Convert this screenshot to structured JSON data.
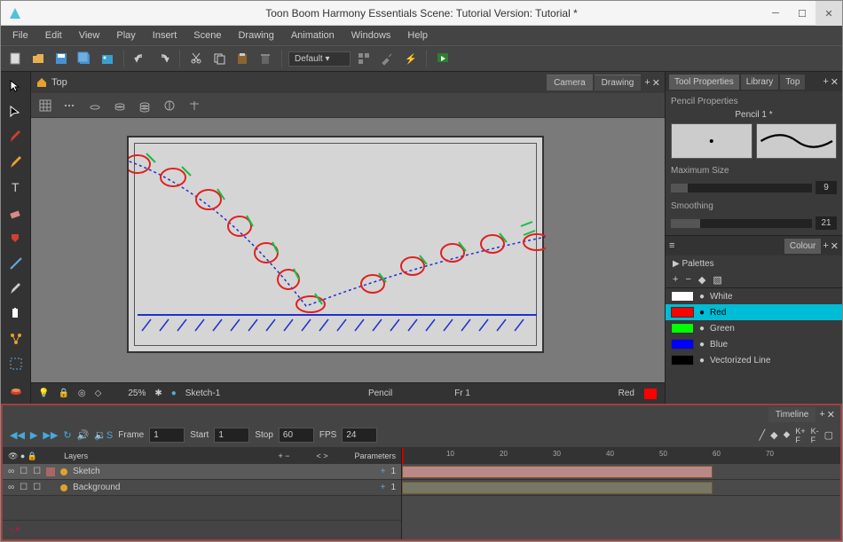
{
  "title": "Toon Boom Harmony Essentials Scene: Tutorial Version: Tutorial *",
  "menu": [
    "File",
    "Edit",
    "View",
    "Play",
    "Insert",
    "Scene",
    "Drawing",
    "Animation",
    "Windows",
    "Help"
  ],
  "toolbar": {
    "preset": "Default"
  },
  "canvas": {
    "top_label": "Top",
    "tabs": [
      "Camera",
      "Drawing"
    ],
    "active_tab": "Camera"
  },
  "status": {
    "zoom": "25%",
    "layer": "Sketch-1",
    "tool": "Pencil",
    "frame": "Fr 1",
    "colour": "Red"
  },
  "tool_props": {
    "tabs": [
      "Tool Properties",
      "Library",
      "Top"
    ],
    "section": "Pencil Properties",
    "brush_name": "Pencil 1 *",
    "max_size_label": "Maximum Size",
    "max_size": "9",
    "smoothing_label": "Smoothing",
    "smoothing": "21"
  },
  "colour": {
    "title": "Colour",
    "palettes": "Palettes",
    "items": [
      {
        "name": "White",
        "hex": "#ffffff"
      },
      {
        "name": "Red",
        "hex": "#ff0000"
      },
      {
        "name": "Green",
        "hex": "#00ff00"
      },
      {
        "name": "Blue",
        "hex": "#0000ff"
      },
      {
        "name": "Vectorized Line",
        "hex": "#000000"
      }
    ],
    "active": 1
  },
  "timeline": {
    "title": "Timeline",
    "frame_label": "Frame",
    "frame": "1",
    "start_label": "Start",
    "start": "1",
    "stop_label": "Stop",
    "stop": "60",
    "fps_label": "FPS",
    "fps": "24",
    "layers_header_1": "Layers",
    "layers_header_2": "Parameters",
    "layers": [
      {
        "name": "Sketch",
        "param": "1",
        "colour": "#e0a030"
      },
      {
        "name": "Background",
        "param": "1",
        "colour": "#e0a030"
      }
    ],
    "ruler": [
      "10",
      "20",
      "30",
      "40",
      "50",
      "60",
      "70"
    ]
  }
}
